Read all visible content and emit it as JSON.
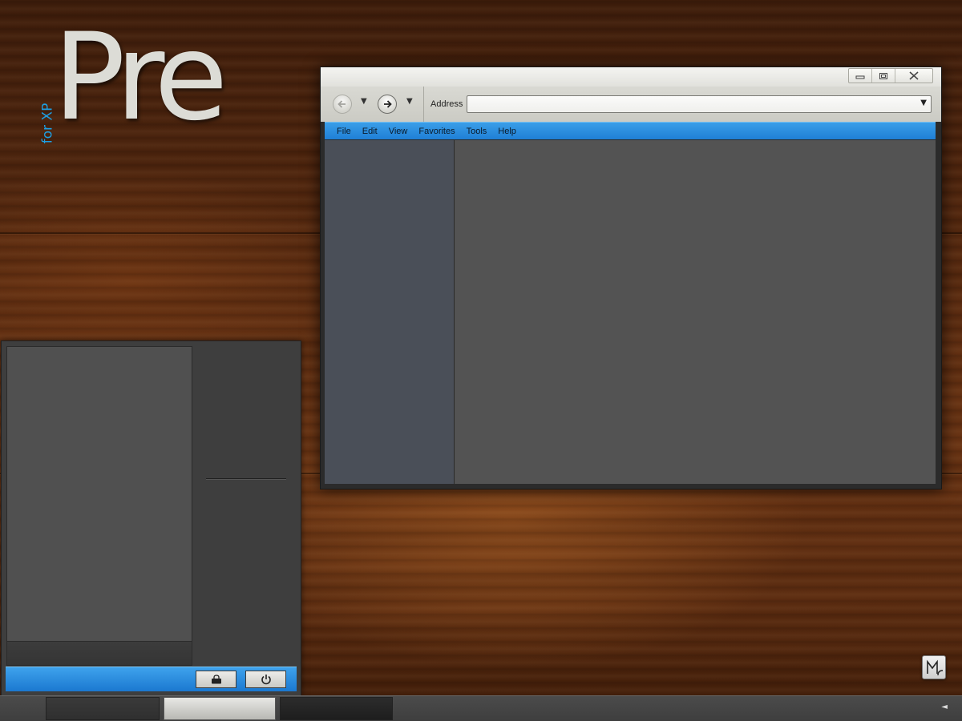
{
  "logo": {
    "title": "Pre",
    "subtitle": "for XP",
    "subtitle_color": "#1d9fe3"
  },
  "window": {
    "caption_buttons": [
      "minimize-icon",
      "restore-icon",
      "close-icon"
    ],
    "nav": {
      "back_icon": "back-arrow-icon",
      "forward_icon": "forward-arrow-icon",
      "dropdown_glyph": "▼"
    },
    "address": {
      "label": "Address",
      "value": "",
      "dropdown_glyph": "▼"
    },
    "menu": {
      "file": "File",
      "edit": "Edit",
      "view": "View",
      "favorites": "Favorites",
      "tools": "Tools",
      "help": "Help"
    },
    "menubar_color": "#1f7fd6"
  },
  "startmenu": {
    "footer_color": "#1b78d0",
    "footer_buttons": [
      "lock-icon",
      "power-icon"
    ]
  },
  "taskbar": {
    "tray_arrow": "◄",
    "task_buttons": [
      "dark",
      "active",
      "dark"
    ]
  },
  "colors": {
    "accent": "#1f7fd6",
    "wood": "#5a2b10"
  }
}
